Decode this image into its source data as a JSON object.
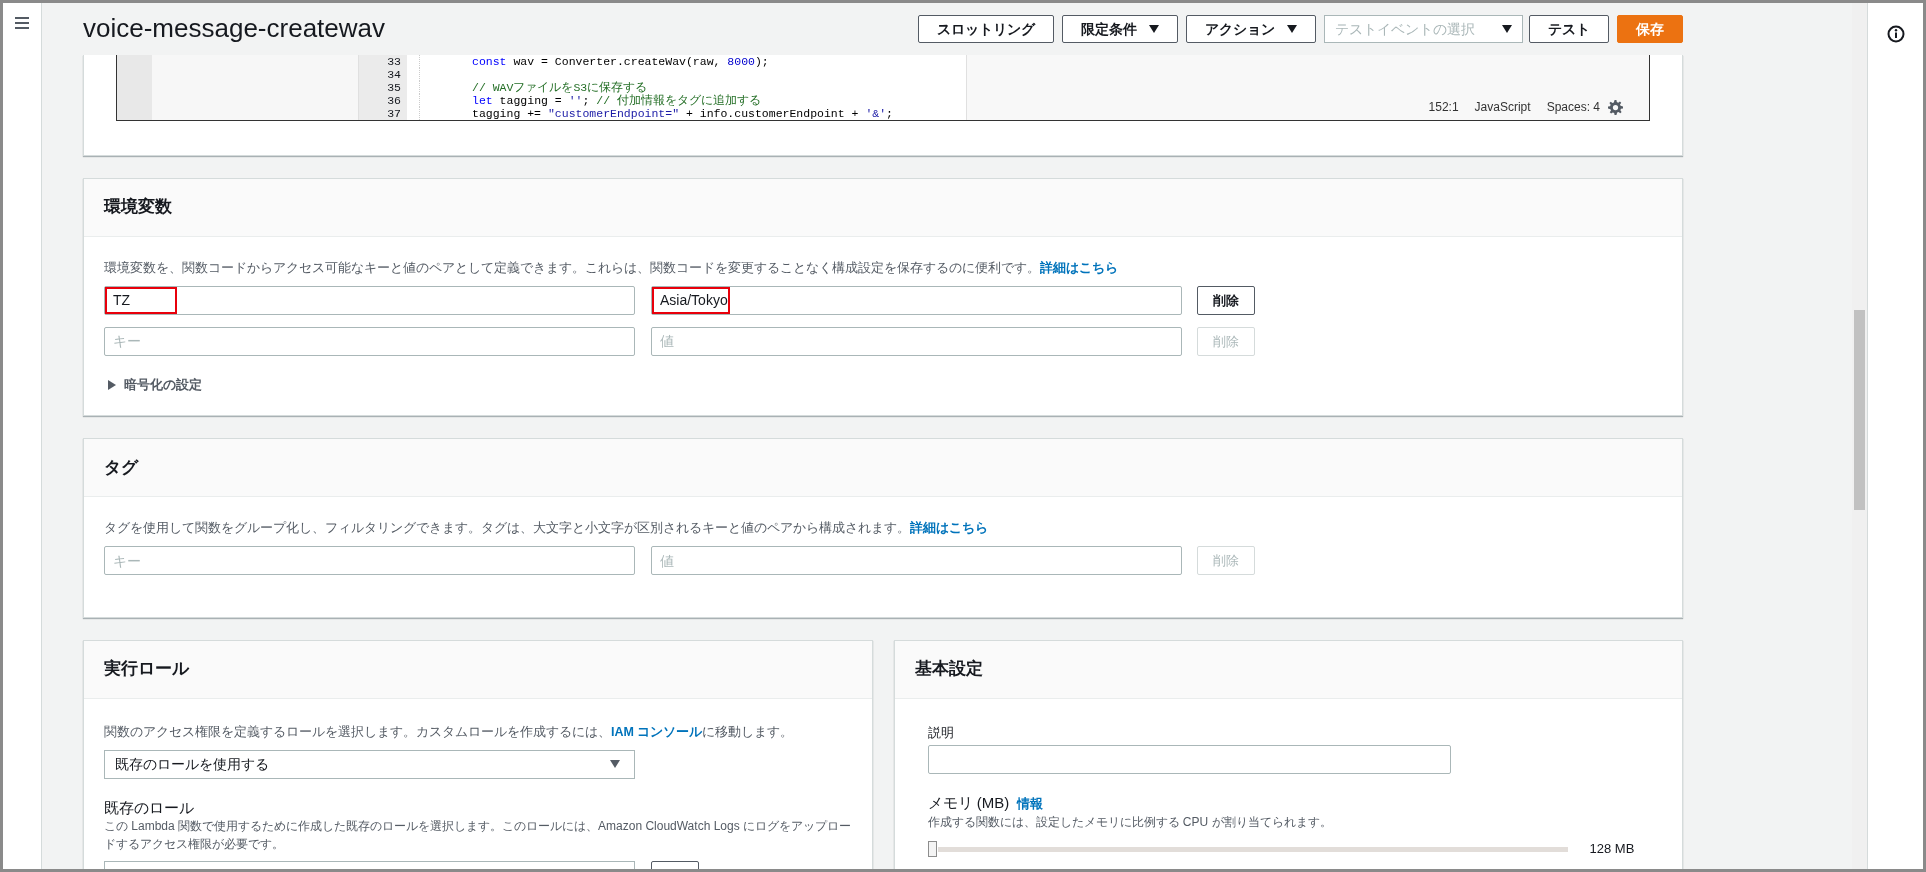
{
  "header": {
    "title": "voice-message-createwav",
    "buttons": [
      {
        "kind": "plain",
        "label": "スロットリング"
      },
      {
        "kind": "dropdown",
        "label": "限定条件"
      },
      {
        "kind": "dropdown",
        "label": "アクション"
      },
      {
        "kind": "select",
        "placeholder": "テストイベントの選択"
      },
      {
        "kind": "plain",
        "label": "テスト"
      },
      {
        "kind": "primary",
        "label": "保存"
      }
    ]
  },
  "editor": {
    "lines": [
      {
        "number": "33",
        "tokens": [
          {
            "kind": "keyword",
            "text": "const"
          },
          {
            "kind": "plain",
            "text": " wav = Converter.createWav(raw, "
          },
          {
            "kind": "number",
            "text": "8000"
          },
          {
            "kind": "plain",
            "text": ");"
          }
        ]
      },
      {
        "number": "34"
      },
      {
        "number": "35",
        "tokens": [
          {
            "kind": "comment",
            "text": "// WAVファイルをS3に保存する"
          }
        ]
      },
      {
        "number": "36",
        "tokens": [
          {
            "kind": "keyword",
            "text": "let"
          },
          {
            "kind": "plain",
            "text": " tagging = "
          },
          {
            "kind": "string",
            "text": "''"
          },
          {
            "kind": "plain",
            "text": "; "
          },
          {
            "kind": "comment",
            "text": "// 付加情報をタグに追加する"
          }
        ]
      },
      {
        "number": "37",
        "tokens": [
          {
            "kind": "plain",
            "text": "tagging += "
          },
          {
            "kind": "string",
            "text": "\"customerEndpoint=\""
          },
          {
            "kind": "plain",
            "text": " + info.customerEndpoint + "
          },
          {
            "kind": "string",
            "text": "'&'"
          },
          {
            "kind": "plain",
            "text": ";"
          }
        ]
      }
    ],
    "status": {
      "position": "152:1",
      "language": "JavaScript",
      "spaces": "Spaces: 4"
    }
  },
  "environment": {
    "title": "環境変数",
    "description": "環境変数を、関数コードからアクセス可能なキーと値のペアとして定義できます。これらは、関数コードを変更することなく構成設定を保存するのに便利です。",
    "link": "詳細はこちら",
    "rows": [
      {
        "key": "TZ",
        "value": "Asia/Tokyo",
        "highlighted": true,
        "delete_label": "削除",
        "disabled": false
      },
      {
        "key_placeholder": "キー",
        "value_placeholder": "値",
        "delete_label": "削除",
        "disabled": true
      }
    ],
    "encryption": {
      "label": "暗号化の設定",
      "expanded": false
    }
  },
  "tags": {
    "title": "タグ",
    "description": "タグを使用して関数をグループ化し、フィルタリングできます。タグは、大文字と小文字が区別されるキーと値のペアから構成されます。",
    "link": "詳細はこちら",
    "rows": [
      {
        "key_placeholder": "キー",
        "value_placeholder": "値",
        "delete_label": "削除",
        "disabled": true
      }
    ]
  },
  "execution_role": {
    "title": "実行ロール",
    "description_before": "関数のアクセス権限を定義するロールを選択します。カスタムロールを作成するには、",
    "link": "IAM コンソール",
    "description_after": "に移動します。",
    "select_value": "既存のロールを使用する",
    "existing_label": "既存のロール",
    "existing_hint": "この Lambda 関数で使用するために作成した既存のロールを選択します。このロールには、Amazon CloudWatch Logs にログをアップロードするアクセス権限が必要です。"
  },
  "basic_settings": {
    "title": "基本設定",
    "description_label": "説明",
    "memory_label": "メモリ (MB)",
    "memory_link": "情報",
    "memory_hint": "作成する関数には、設定したメモリに比例する CPU が割り当てられます。",
    "memory": {
      "level": 0,
      "reading": "128 MB"
    }
  }
}
